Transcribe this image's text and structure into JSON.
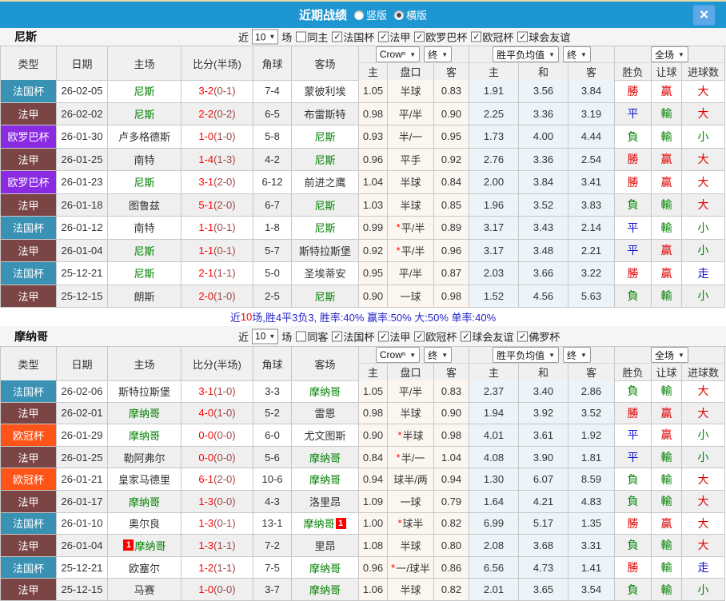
{
  "titlebar": {
    "title": "近期战绩",
    "vertical_label": "竖版",
    "horizontal_label": "横版",
    "vertical_selected": false,
    "horizontal_selected": true,
    "close_glyph": "×"
  },
  "table_header": {
    "type": "类型",
    "date": "日期",
    "home": "主场",
    "score": "比分(半场)",
    "corner": "角球",
    "away": "客场",
    "bookmaker": "Crowⁿ",
    "final": "终",
    "avg": "胜平负均值",
    "final2": "终",
    "full": "全场",
    "sub_home": "主",
    "sub_handicap": "盘口",
    "sub_away": "客",
    "sub_avg_home": "主",
    "sub_avg_draw": "和",
    "sub_avg_away": "客",
    "sub_wdl": "胜负",
    "sub_let": "让球",
    "sub_goals": "进球数"
  },
  "colors": {
    "topbar": "#1E96D2",
    "top_strip": "#E7DCA8",
    "close_bg": "#5FA8E8",
    "leagues": {
      "法国杯": "#3992B4",
      "法甲": "#7B4545",
      "欧罗巴杯": "#8A2BE2",
      "欧冠杯": "#FF5419"
    },
    "team_green": "#008000",
    "score_ft": "#FF0000",
    "score_ht": "#A04545",
    "cream_bg": "#FBF7F0",
    "ltblue_bg": "#EBF4F8",
    "stripe": "#EFEFEF",
    "red": "#DD0000",
    "green": "#008000",
    "blue": "#1414CC",
    "result": {
      "勝": "red",
      "平": "blue",
      "負": "green",
      "贏": "red",
      "輸": "green",
      "大": "red",
      "小": "green",
      "走": "blue"
    }
  },
  "sections": [
    {
      "team": "尼斯",
      "filter": {
        "near_label": "近",
        "count": "10",
        "games_label": "场",
        "same_label": "同主",
        "same_checked": false,
        "leagues": [
          "法国杯",
          "法甲",
          "欧罗巴杯",
          "欧冠杯",
          "球会友谊"
        ],
        "league_checked": [
          true,
          true,
          true,
          true,
          true
        ]
      },
      "rows": [
        {
          "type": "法国杯",
          "date": "26-02-05",
          "home": "尼斯",
          "home_team": true,
          "score": "3-2",
          "half": "(0-1)",
          "corner": "7-4",
          "away": "蒙彼利埃",
          "away_team": false,
          "oh": "1.05",
          "hcap": "半球",
          "star": false,
          "oa": "0.83",
          "ah": "1.91",
          "ad": "3.56",
          "aa": "3.84",
          "r1": "勝",
          "r2": "贏",
          "r3": "大"
        },
        {
          "type": "法甲",
          "date": "26-02-02",
          "home": "尼斯",
          "home_team": true,
          "score": "2-2",
          "half": "(0-2)",
          "corner": "6-5",
          "away": "布雷斯特",
          "away_team": false,
          "oh": "0.98",
          "hcap": "平/半",
          "star": false,
          "oa": "0.90",
          "ah": "2.25",
          "ad": "3.36",
          "aa": "3.19",
          "r1": "平",
          "r2": "輸",
          "r3": "大"
        },
        {
          "type": "欧罗巴杯",
          "date": "26-01-30",
          "home": "卢多格德斯",
          "home_team": false,
          "score": "1-0",
          "half": "(1-0)",
          "corner": "5-8",
          "away": "尼斯",
          "away_team": true,
          "oh": "0.93",
          "hcap": "半/一",
          "star": false,
          "oa": "0.95",
          "ah": "1.73",
          "ad": "4.00",
          "aa": "4.44",
          "r1": "負",
          "r2": "輸",
          "r3": "小"
        },
        {
          "type": "法甲",
          "date": "26-01-25",
          "home": "南特",
          "home_team": false,
          "score": "1-4",
          "half": "(1-3)",
          "corner": "4-2",
          "away": "尼斯",
          "away_team": true,
          "oh": "0.96",
          "hcap": "平手",
          "star": false,
          "oa": "0.92",
          "ah": "2.76",
          "ad": "3.36",
          "aa": "2.54",
          "r1": "勝",
          "r2": "贏",
          "r3": "大"
        },
        {
          "type": "欧罗巴杯",
          "date": "26-01-23",
          "home": "尼斯",
          "home_team": true,
          "score": "3-1",
          "half": "(2-0)",
          "corner": "6-12",
          "away": "前进之鹰",
          "away_team": false,
          "oh": "1.04",
          "hcap": "半球",
          "star": false,
          "oa": "0.84",
          "ah": "2.00",
          "ad": "3.84",
          "aa": "3.41",
          "r1": "勝",
          "r2": "贏",
          "r3": "大"
        },
        {
          "type": "法甲",
          "date": "26-01-18",
          "home": "图鲁兹",
          "home_team": false,
          "score": "5-1",
          "half": "(2-0)",
          "corner": "6-7",
          "away": "尼斯",
          "away_team": true,
          "oh": "1.03",
          "hcap": "半球",
          "star": false,
          "oa": "0.85",
          "ah": "1.96",
          "ad": "3.52",
          "aa": "3.83",
          "r1": "負",
          "r2": "輸",
          "r3": "大"
        },
        {
          "type": "法国杯",
          "date": "26-01-12",
          "home": "南特",
          "home_team": false,
          "score": "1-1",
          "half": "(0-1)",
          "corner": "1-8",
          "away": "尼斯",
          "away_team": true,
          "oh": "0.99",
          "hcap": "平/半",
          "star": true,
          "oa": "0.89",
          "ah": "3.17",
          "ad": "3.43",
          "aa": "2.14",
          "r1": "平",
          "r2": "輸",
          "r3": "小"
        },
        {
          "type": "法甲",
          "date": "26-01-04",
          "home": "尼斯",
          "home_team": true,
          "score": "1-1",
          "half": "(0-1)",
          "corner": "5-7",
          "away": "斯特拉斯堡",
          "away_team": false,
          "oh": "0.92",
          "hcap": "平/半",
          "star": true,
          "oa": "0.96",
          "ah": "3.17",
          "ad": "3.48",
          "aa": "2.21",
          "r1": "平",
          "r2": "贏",
          "r3": "小"
        },
        {
          "type": "法国杯",
          "date": "25-12-21",
          "home": "尼斯",
          "home_team": true,
          "score": "2-1",
          "half": "(1-1)",
          "corner": "5-0",
          "away": "圣埃蒂安",
          "away_team": false,
          "oh": "0.95",
          "hcap": "平/半",
          "star": false,
          "oa": "0.87",
          "ah": "2.03",
          "ad": "3.66",
          "aa": "3.22",
          "r1": "勝",
          "r2": "贏",
          "r3": "走"
        },
        {
          "type": "法甲",
          "date": "25-12-15",
          "home": "朗斯",
          "home_team": false,
          "score": "2-0",
          "half": "(1-0)",
          "corner": "2-5",
          "away": "尼斯",
          "away_team": true,
          "oh": "0.90",
          "hcap": "一球",
          "star": false,
          "oa": "0.98",
          "ah": "1.52",
          "ad": "4.56",
          "aa": "5.63",
          "r1": "負",
          "r2": "輸",
          "r3": "小"
        }
      ],
      "summary": {
        "pre": "近",
        "num": "10",
        "post": "场,胜4平3负3, 胜率:40% 赢率:50% 大:50% 单率:40%"
      }
    },
    {
      "team": "摩纳哥",
      "filter": {
        "near_label": "近",
        "count": "10",
        "games_label": "场",
        "same_label": "同客",
        "same_checked": false,
        "leagues": [
          "法国杯",
          "法甲",
          "欧冠杯",
          "球会友谊",
          "佛罗杯"
        ],
        "league_checked": [
          true,
          true,
          true,
          true,
          true
        ]
      },
      "rows": [
        {
          "type": "法国杯",
          "date": "26-02-06",
          "home": "斯特拉斯堡",
          "home_team": false,
          "score": "3-1",
          "half": "(1-0)",
          "corner": "3-3",
          "away": "摩纳哥",
          "away_team": true,
          "oh": "1.05",
          "hcap": "平/半",
          "star": false,
          "oa": "0.83",
          "ah": "2.37",
          "ad": "3.40",
          "aa": "2.86",
          "r1": "負",
          "r2": "輸",
          "r3": "大"
        },
        {
          "type": "法甲",
          "date": "26-02-01",
          "home": "摩纳哥",
          "home_team": true,
          "score": "4-0",
          "half": "(1-0)",
          "corner": "5-2",
          "away": "雷恩",
          "away_team": false,
          "oh": "0.98",
          "hcap": "半球",
          "star": false,
          "oa": "0.90",
          "ah": "1.94",
          "ad": "3.92",
          "aa": "3.52",
          "r1": "勝",
          "r2": "贏",
          "r3": "大"
        },
        {
          "type": "欧冠杯",
          "date": "26-01-29",
          "home": "摩纳哥",
          "home_team": true,
          "score": "0-0",
          "half": "(0-0)",
          "corner": "6-0",
          "away": "尤文图斯",
          "away_team": false,
          "oh": "0.90",
          "hcap": "半球",
          "star": true,
          "oa": "0.98",
          "ah": "4.01",
          "ad": "3.61",
          "aa": "1.92",
          "r1": "平",
          "r2": "贏",
          "r3": "小"
        },
        {
          "type": "法甲",
          "date": "26-01-25",
          "home": "勒阿弗尔",
          "home_team": false,
          "score": "0-0",
          "half": "(0-0)",
          "corner": "5-6",
          "away": "摩纳哥",
          "away_team": true,
          "oh": "0.84",
          "hcap": "半/一",
          "star": true,
          "oa": "1.04",
          "ah": "4.08",
          "ad": "3.90",
          "aa": "1.81",
          "r1": "平",
          "r2": "輸",
          "r3": "小"
        },
        {
          "type": "欧冠杯",
          "date": "26-01-21",
          "home": "皇家马德里",
          "home_team": false,
          "score": "6-1",
          "half": "(2-0)",
          "corner": "10-6",
          "away": "摩纳哥",
          "away_team": true,
          "oh": "0.94",
          "hcap": "球半/两",
          "star": false,
          "oa": "0.94",
          "ah": "1.30",
          "ad": "6.07",
          "aa": "8.59",
          "r1": "負",
          "r2": "輸",
          "r3": "大"
        },
        {
          "type": "法甲",
          "date": "26-01-17",
          "home": "摩纳哥",
          "home_team": true,
          "score": "1-3",
          "half": "(0-0)",
          "corner": "4-3",
          "away": "洛里昂",
          "away_team": false,
          "oh": "1.09",
          "hcap": "一球",
          "star": false,
          "oa": "0.79",
          "ah": "1.64",
          "ad": "4.21",
          "aa": "4.83",
          "r1": "負",
          "r2": "輸",
          "r3": "大"
        },
        {
          "type": "法国杯",
          "date": "26-01-10",
          "home": "奥尔良",
          "home_team": false,
          "score": "1-3",
          "half": "(0-1)",
          "corner": "13-1",
          "away": "摩纳哥",
          "away_team": true,
          "away_badge": "1",
          "away_badge_pos": "after",
          "oh": "1.00",
          "hcap": "球半",
          "star": true,
          "oa": "0.82",
          "ah": "6.99",
          "ad": "5.17",
          "aa": "1.35",
          "r1": "勝",
          "r2": "贏",
          "r3": "大"
        },
        {
          "type": "法甲",
          "date": "26-01-04",
          "home": "摩纳哥",
          "home_team": true,
          "home_badge": "1",
          "home_badge_pos": "before",
          "score": "1-3",
          "half": "(1-1)",
          "corner": "7-2",
          "away": "里昂",
          "away_team": false,
          "oh": "1.08",
          "hcap": "半球",
          "star": false,
          "oa": "0.80",
          "ah": "2.08",
          "ad": "3.68",
          "aa": "3.31",
          "r1": "負",
          "r2": "輸",
          "r3": "大"
        },
        {
          "type": "法国杯",
          "date": "25-12-21",
          "home": "欧塞尔",
          "home_team": false,
          "score": "1-2",
          "half": "(1-1)",
          "corner": "7-5",
          "away": "摩纳哥",
          "away_team": true,
          "oh": "0.96",
          "hcap": "一/球半",
          "star": true,
          "oa": "0.86",
          "ah": "6.56",
          "ad": "4.73",
          "aa": "1.41",
          "r1": "勝",
          "r2": "輸",
          "r3": "走"
        },
        {
          "type": "法甲",
          "date": "25-12-15",
          "home": "马赛",
          "home_team": false,
          "score": "1-0",
          "half": "(0-0)",
          "corner": "3-7",
          "away": "摩纳哥",
          "away_team": true,
          "oh": "1.06",
          "hcap": "半球",
          "star": false,
          "oa": "0.82",
          "ah": "2.01",
          "ad": "3.65",
          "aa": "3.54",
          "r1": "負",
          "r2": "輸",
          "r3": "小"
        }
      ],
      "summary": null
    }
  ]
}
